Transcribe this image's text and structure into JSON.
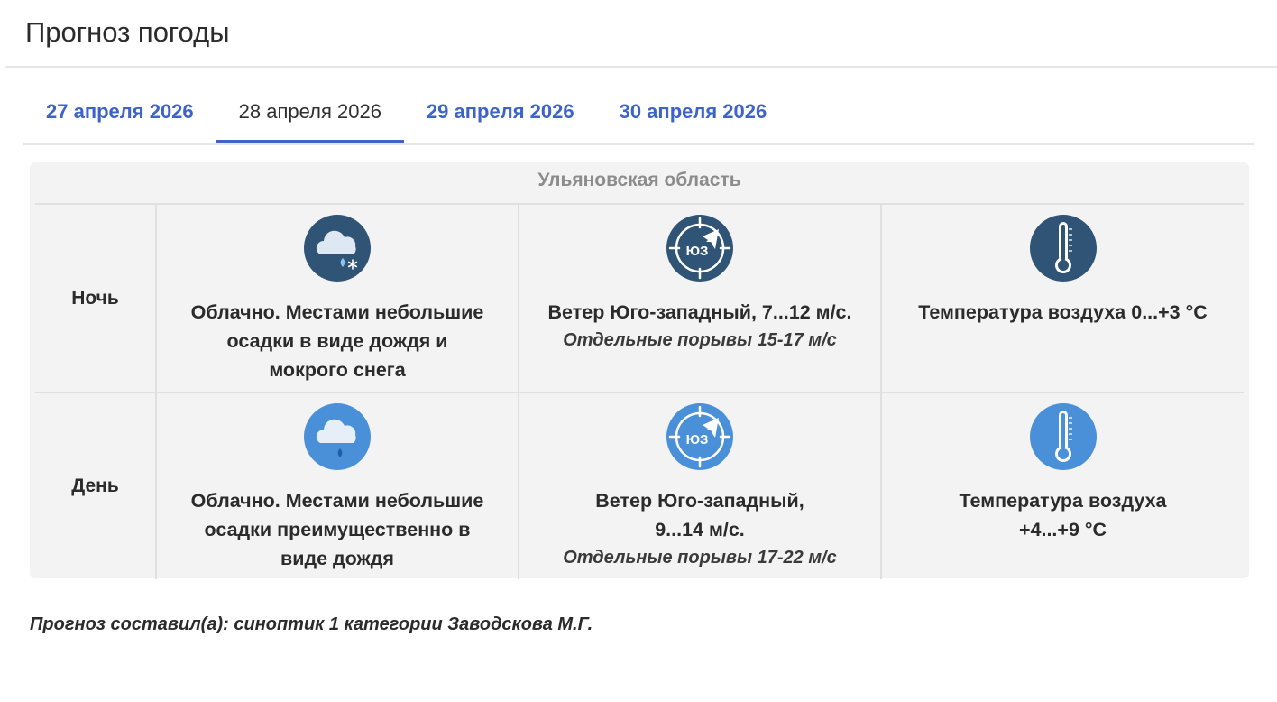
{
  "header": {
    "title": "Прогноз погоды"
  },
  "tabs": [
    {
      "label": "27 апреля 2026",
      "active": false
    },
    {
      "label": "28 апреля 2026",
      "active": true
    },
    {
      "label": "29 апреля 2026",
      "active": false
    },
    {
      "label": "30 апреля 2026",
      "active": false
    }
  ],
  "forecast": {
    "region": "Ульяновская область",
    "rows": [
      {
        "period": "Ночь",
        "icon_color": "#2f5476",
        "weather_icon": "cloud-rain-snow-icon",
        "weather": [
          "Облачно. Местами небольшие",
          "осадки в виде дождя и",
          "мокрого снега"
        ],
        "wind_icon": "wind-southwest-icon",
        "wind_dir_label": "ЮЗ",
        "wind": [
          "Ветер Юго-западный, 7...12 м/с."
        ],
        "gusts": "Отдельные порывы 15-17 м/с",
        "temp_icon": "thermometer-icon",
        "temp": [
          "Температура воздуха 0...+3 °С"
        ]
      },
      {
        "period": "День",
        "icon_color": "#4a90d9",
        "weather_icon": "cloud-rain-icon",
        "weather": [
          "Облачно. Местами небольшие",
          "осадки преимущественно в",
          "виде дождя"
        ],
        "wind_icon": "wind-southwest-icon",
        "wind_dir_label": "ЮЗ",
        "wind": [
          "Ветер Юго-западный,",
          "9...14 м/с."
        ],
        "gusts": "Отдельные порывы 17-22 м/с",
        "temp_icon": "thermometer-icon",
        "temp": [
          "Температура воздуха",
          "+4...+9 °С"
        ]
      }
    ]
  },
  "footer": {
    "author": "Прогноз составил(а): синоптик 1 категории Заводскова М.Г."
  }
}
